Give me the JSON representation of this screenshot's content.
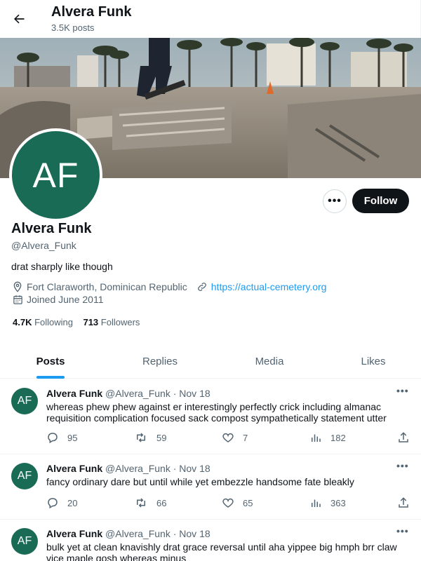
{
  "header": {
    "name": "Alvera Funk",
    "posts_count": "3.5K posts"
  },
  "profile": {
    "avatar_initials": "AF",
    "name": "Alvera Funk",
    "handle": "@Alvera_Funk",
    "bio": "drat sharply like though",
    "location": "Fort Claraworth, Dominican Republic",
    "website": "https://actual-cemetery.org",
    "joined": "Joined June 2011",
    "following_count": "4.7K",
    "following_label": "Following",
    "followers_count": "713",
    "followers_label": "Followers"
  },
  "buttons": {
    "more": "•••",
    "follow": "Follow"
  },
  "tabs": [
    {
      "label": "Posts",
      "active": true
    },
    {
      "label": "Replies",
      "active": false
    },
    {
      "label": "Media",
      "active": false
    },
    {
      "label": "Likes",
      "active": false
    }
  ],
  "posts": [
    {
      "avatar_initials": "AF",
      "name": "Alvera Funk",
      "handle_date": "@Alvera_Funk · Nov 18",
      "text": "whereas phew phew against er interestingly perfectly crick including almanac requisition complication focused sack compost sympathetically statement utter",
      "replies": "95",
      "reposts": "59",
      "likes": "7",
      "views": "182"
    },
    {
      "avatar_initials": "AF",
      "name": "Alvera Funk",
      "handle_date": "@Alvera_Funk · Nov 18",
      "text": "fancy ordinary dare but until while yet embezzle handsome fate bleakly",
      "replies": "20",
      "reposts": "66",
      "likes": "65",
      "views": "363"
    },
    {
      "avatar_initials": "AF",
      "name": "Alvera Funk",
      "handle_date": "@Alvera_Funk · Nov 18",
      "text": "bulk yet at clean knavishly drat grace reversal until aha yippee big hmph brr claw vice maple gosh whereas minus",
      "replies": "",
      "reposts": "",
      "likes": "",
      "views": ""
    }
  ],
  "colors": {
    "accent": "#1d9bf0",
    "avatar_bg": "#1a6b56",
    "text": "#0f1419",
    "muted": "#536471"
  }
}
